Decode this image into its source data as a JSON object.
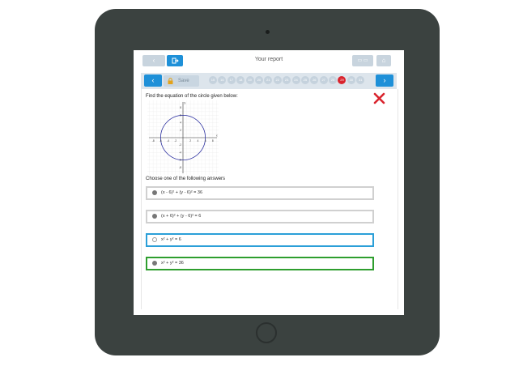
{
  "header": {
    "title": "Your report",
    "back_icon": "chevron-left-icon",
    "exit_icon": "exit-icon",
    "home_icon": "home-icon"
  },
  "navbar": {
    "save_label": "Save",
    "current_question": "29",
    "questions": [
      "1",
      "2",
      "3",
      "4",
      "5",
      "6",
      "7",
      "8",
      "9",
      "10",
      "11",
      "12",
      "13",
      "14",
      "15",
      "16",
      "17",
      "18",
      "19",
      "20",
      "21",
      "22",
      "23",
      "24",
      "25",
      "26",
      "27",
      "28",
      "29",
      "30",
      "31",
      "32"
    ]
  },
  "question": {
    "text": "Find the equation of the circle given below:",
    "prompt": "Choose one of the following answers",
    "status": "incorrect"
  },
  "graph": {
    "x_ticks": [
      "-8",
      "-6",
      "-4",
      "-2",
      "0",
      "2",
      "4",
      "6",
      "8"
    ],
    "y_ticks": [
      "8",
      "6",
      "4",
      "2",
      "-2",
      "-4",
      "-6",
      "-8"
    ],
    "x_label": "x",
    "y_label": "y",
    "circle": {
      "center_x": 0,
      "center_y": 0,
      "radius": 6
    }
  },
  "answers": [
    {
      "label": "(x - 6)² + (y - 6)² = 36",
      "state": "default"
    },
    {
      "label": "(x + 6)² + (y - 6)² = 6",
      "state": "default"
    },
    {
      "label": "x² + y² = 6",
      "state": "selected"
    },
    {
      "label": "x² + y² = 36",
      "state": "correct"
    }
  ],
  "colors": {
    "accent": "#1e90d8",
    "wrong": "#d9232d",
    "correct": "#2e9e2e",
    "selected": "#2b9fd8"
  }
}
